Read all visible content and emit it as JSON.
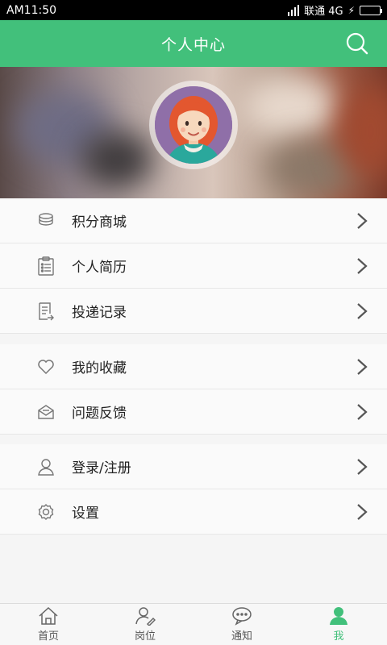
{
  "status_bar": {
    "time": "AM11:50",
    "carrier": "联通 4G"
  },
  "header": {
    "title": "个人中心"
  },
  "menu_groups": [
    {
      "items": [
        {
          "label": "积分商城",
          "icon": "coins-icon"
        },
        {
          "label": "个人简历",
          "icon": "resume-icon"
        },
        {
          "label": "投递记录",
          "icon": "record-icon"
        }
      ]
    },
    {
      "items": [
        {
          "label": "我的收藏",
          "icon": "heart-icon"
        },
        {
          "label": "问题反馈",
          "icon": "mail-icon"
        }
      ]
    },
    {
      "items": [
        {
          "label": "登录/注册",
          "icon": "user-icon"
        },
        {
          "label": "设置",
          "icon": "gear-icon"
        }
      ]
    }
  ],
  "bottom_nav": [
    {
      "label": "首页",
      "icon": "home-icon"
    },
    {
      "label": "岗位",
      "icon": "job-icon"
    },
    {
      "label": "通知",
      "icon": "chat-icon"
    },
    {
      "label": "我",
      "icon": "me-icon",
      "active": true
    }
  ],
  "colors": {
    "primary": "#42c07b"
  }
}
